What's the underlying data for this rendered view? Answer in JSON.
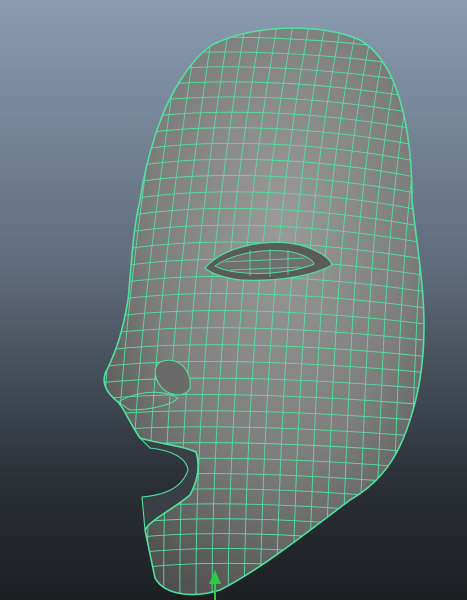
{
  "viewport": {
    "background_top": "#8a9bb0",
    "background_bottom": "#1c1f22"
  },
  "mesh": {
    "object": "head",
    "display_mode": "wireframe-on-shaded",
    "surface_color": "#7d7d7d",
    "wireframe_color": "#52e0a0",
    "selected": true
  },
  "manipulator": {
    "icon": "move-axis-y-icon",
    "color": "#2ecc40"
  }
}
